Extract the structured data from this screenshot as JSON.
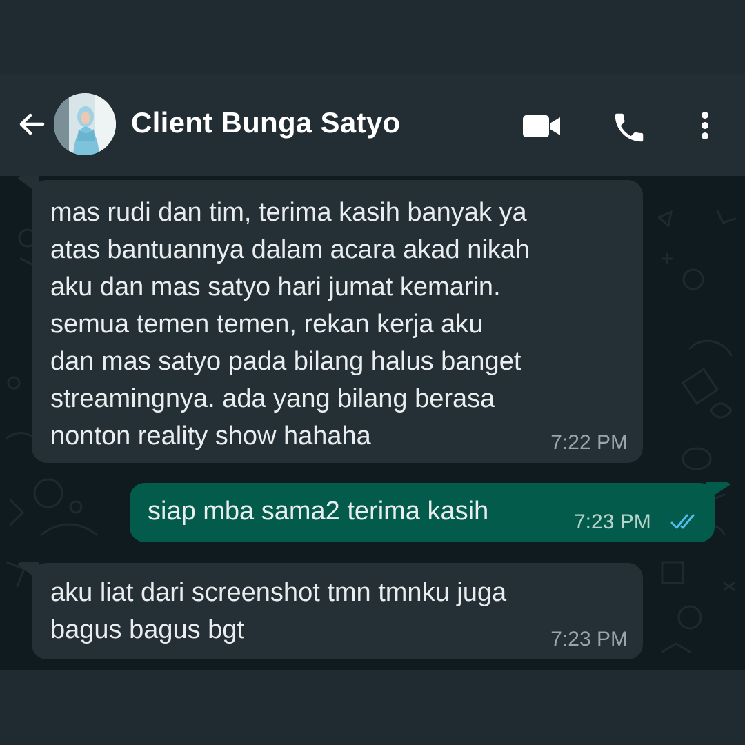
{
  "header": {
    "contact_name": "Client Bunga Satyo",
    "icons": [
      "back-arrow-icon",
      "avatar",
      "video-call-icon",
      "phone-icon",
      "more-vert-icon"
    ]
  },
  "messages": [
    {
      "direction": "incoming",
      "text": "mas rudi dan tim, terima kasih banyak ya\natas bantuannya dalam acara akad nikah\naku dan mas satyo hari jumat kemarin.\nsemua temen temen, rekan kerja aku\ndan mas satyo pada bilang halus banget\nstreamingnya. ada yang bilang berasa\nnonton reality show hahaha",
      "time": "7:22 PM"
    },
    {
      "direction": "outgoing",
      "text": "siap mba sama2 terima kasih",
      "time": "7:23 PM",
      "status": "read"
    },
    {
      "direction": "incoming",
      "text": "aku liat dari screenshot tmn tmnku juga\nbagus bagus bgt",
      "time": "7:23 PM"
    }
  ],
  "colors": {
    "app_bar": "#222d34",
    "chat_background": "#101b20",
    "incoming_bubble": "#242f36",
    "outgoing_bubble": "#035c4b",
    "read_ticks": "#53bdeb"
  }
}
